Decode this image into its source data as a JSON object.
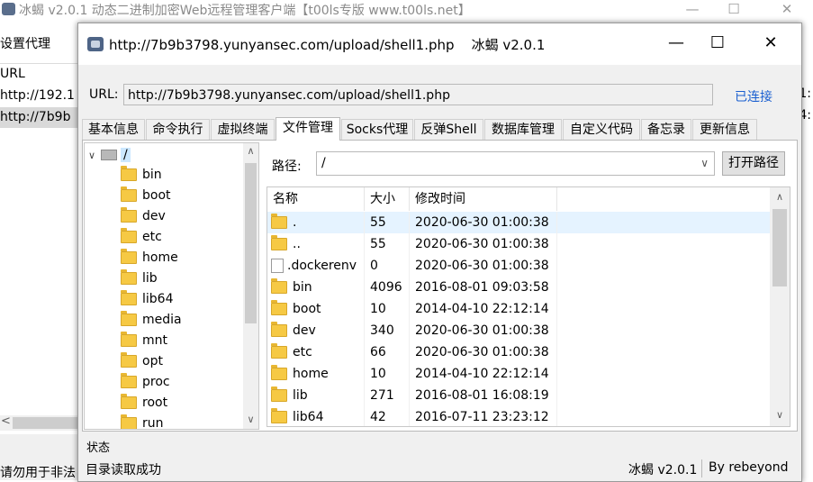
{
  "main_window": {
    "title": "冰蝎 v2.0.1 动态二进制加密Web远程管理客户端【t00ls专版 www.t00ls.net】",
    "proxy_menu": "设置代理",
    "list_header": "URL",
    "list_rows": [
      "http://192.1",
      "http://7b9b"
    ],
    "right_fragments": [
      "1:",
      "4:"
    ],
    "warning_fragment": "请勿用于非法"
  },
  "dialog": {
    "title": "http://7b9b3798.yunyansec.com/upload/shell1.php    冰蝎 v2.0.1",
    "url_label": "URL:",
    "url_value": "http://7b9b3798.yunyansec.com/upload/shell1.php",
    "connection_status": "已连接",
    "tabs": [
      "基本信息",
      "命令执行",
      "虚拟终端",
      "文件管理",
      "Socks代理",
      "反弹Shell",
      "数据库管理",
      "自定义代码",
      "备忘录",
      "更新信息"
    ],
    "active_tab": "文件管理",
    "file_manager": {
      "tree_root": "/",
      "tree_folders": [
        "bin",
        "boot",
        "dev",
        "etc",
        "home",
        "lib",
        "lib64",
        "media",
        "mnt",
        "opt",
        "proc",
        "root",
        "run"
      ],
      "path_label": "路径:",
      "path_value": "/",
      "open_button": "打开路径",
      "columns": [
        "名称",
        "大小",
        "修改时间"
      ],
      "files": [
        {
          "name": ".",
          "size": "55",
          "time": "2020-06-30 01:00:38",
          "type": "folder"
        },
        {
          "name": "..",
          "size": "55",
          "time": "2020-06-30 01:00:38",
          "type": "folder"
        },
        {
          "name": ".dockerenv",
          "size": "0",
          "time": "2020-06-30 01:00:38",
          "type": "file"
        },
        {
          "name": "bin",
          "size": "4096",
          "time": "2016-08-01 09:03:58",
          "type": "folder"
        },
        {
          "name": "boot",
          "size": "10",
          "time": "2014-04-10 22:12:14",
          "type": "folder"
        },
        {
          "name": "dev",
          "size": "340",
          "time": "2020-06-30 01:00:38",
          "type": "folder"
        },
        {
          "name": "etc",
          "size": "66",
          "time": "2020-06-30 01:00:38",
          "type": "folder"
        },
        {
          "name": "home",
          "size": "10",
          "time": "2014-04-10 22:12:14",
          "type": "folder"
        },
        {
          "name": "lib",
          "size": "271",
          "time": "2016-08-01 16:08:19",
          "type": "folder"
        },
        {
          "name": "lib64",
          "size": "42",
          "time": "2016-07-11 23:23:12",
          "type": "folder"
        }
      ]
    },
    "status": {
      "title": "状态",
      "message": "目录读取成功",
      "version": "冰蝎 v2.0.1",
      "author": "By rebeyond"
    }
  },
  "colors": {
    "link": "#1a5fd0",
    "selection": "#cce8ff",
    "row_highlight": "#e5f3ff",
    "folder": "#f6c944"
  }
}
